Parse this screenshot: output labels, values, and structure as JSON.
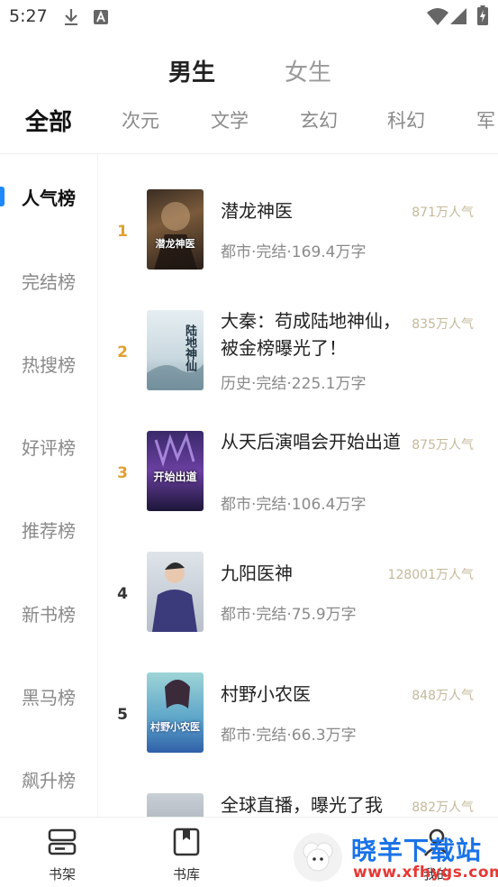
{
  "status_bar": {
    "time": "5:27"
  },
  "gender_tabs": [
    {
      "label": "男生"
    },
    {
      "label": "女生"
    }
  ],
  "categories": [
    "全部",
    "次元",
    "文学",
    "玄幻",
    "科幻",
    "军"
  ],
  "sidebar": [
    "人气榜",
    "完结榜",
    "热搜榜",
    "好评榜",
    "推荐榜",
    "新书榜",
    "黑马榜",
    "飙升榜"
  ],
  "books": [
    {
      "rank": "1",
      "title": "潜龙神医",
      "meta": "都市·完结·169.4万字",
      "popularity": "871万人气",
      "rank_color": "#e0a030",
      "cover_text": "潜龙神医"
    },
    {
      "rank": "2",
      "title": "大秦：苟成陆地神仙，被金榜曝光了！",
      "meta": "历史·完结·225.1万字",
      "popularity": "835万人气",
      "rank_color": "#e0a030",
      "cover_text": "陆地神仙"
    },
    {
      "rank": "3",
      "title": "从天后演唱会开始出道",
      "meta": "都市·完结·106.4万字",
      "popularity": "875万人气",
      "rank_color": "#e0a030",
      "cover_text": "开始出道"
    },
    {
      "rank": "4",
      "title": "九阳医神",
      "meta": "都市·完结·75.9万字",
      "popularity": "128001万人气",
      "rank_color": "#333333",
      "cover_text": ""
    },
    {
      "rank": "5",
      "title": "村野小农医",
      "meta": "都市·完结·66.3万字",
      "popularity": "848万人气",
      "rank_color": "#333333",
      "cover_text": "村野小农医"
    },
    {
      "rank": "",
      "title": "全球直播，曝光了我",
      "meta": "",
      "popularity": "882万人气",
      "rank_color": "#333333",
      "cover_text": ""
    }
  ],
  "bottom_nav": [
    {
      "label": "书架",
      "icon": "bookshelf-icon"
    },
    {
      "label": "书库",
      "icon": "library-icon"
    },
    {
      "label": "我的",
      "icon": "profile-icon"
    }
  ],
  "watermark": {
    "text": "晓羊下载站",
    "url": "www.xfhygs.com"
  }
}
